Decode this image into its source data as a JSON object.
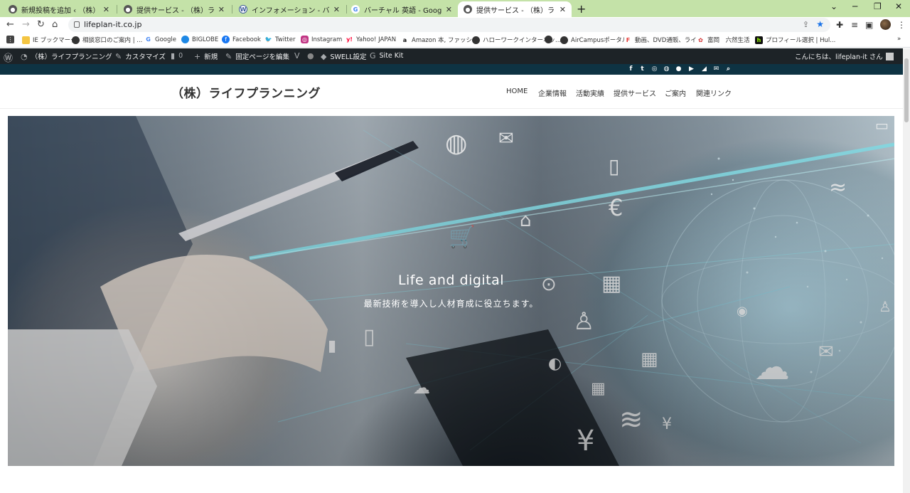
{
  "browser": {
    "tabs": [
      {
        "title": "新規投稿を追加 ‹ （株）ライフプラ",
        "icon": "wp-globe-icon",
        "active": false
      },
      {
        "title": "提供サービス - （株）ライフプランニン",
        "icon": "wp-globe-icon",
        "active": false
      },
      {
        "title": "インフォメーション - バーチャル富岡ス",
        "icon": "wordpress-icon",
        "active": false
      },
      {
        "title": "バーチャル 英語 - Google 検索",
        "icon": "google-icon",
        "active": false
      },
      {
        "title": "提供サービス - （株）ライフプランニン",
        "icon": "wp-globe-icon",
        "active": true
      }
    ],
    "new_tab": "+",
    "url": "lifeplan-it.co.jp",
    "bookmarks": [
      {
        "label": "IE ブックマーク",
        "icon": "folder-icon",
        "color": "#f4c542"
      },
      {
        "label": "相談窓口のご案内 | ...",
        "icon": "globe-icon",
        "color": "#333333"
      },
      {
        "label": "Google",
        "icon": "google-icon",
        "color": "#4285f4"
      },
      {
        "label": "BIGLOBE",
        "icon": "biglobe-icon",
        "color": "#1e88e5"
      },
      {
        "label": "Facebook",
        "icon": "facebook-icon",
        "color": "#1877f2"
      },
      {
        "label": "Twitter",
        "icon": "twitter-icon",
        "color": "#1da1f2"
      },
      {
        "label": "Instagram",
        "icon": "instagram-icon",
        "color": "#c13584"
      },
      {
        "label": "Yahoo! JAPAN",
        "icon": "yahoo-icon",
        "color": "#ff0033"
      },
      {
        "label": "Amazon 本, ファッシ...",
        "icon": "amazon-icon",
        "color": "#111111"
      },
      {
        "label": "ハローワークインターネッ...",
        "icon": "globe-icon",
        "color": "#333333"
      },
      {
        "label": "",
        "icon": "globe-icon",
        "color": "#333333"
      },
      {
        "label": "AirCampusポータル",
        "icon": "globe-icon",
        "color": "#333333"
      },
      {
        "label": "動画、DVD通販、ライ...",
        "icon": "fanza-icon",
        "color": "#e53935"
      },
      {
        "label": "富岡　六然生活",
        "icon": "tomioka-icon",
        "color": "#d32f2f"
      },
      {
        "label": "プロフィール選択 | Hul...",
        "icon": "hulu-icon",
        "color": "#111111"
      }
    ]
  },
  "adminbar": {
    "site_name": "（株）ライフプランニング",
    "customize": "カスタマイズ",
    "comments": "0",
    "new": "新規",
    "edit_page": "固定ページを編集",
    "swell": "SWELL設定",
    "sitekit": "Site Kit",
    "greeting": "こんにちは、lifeplan-it さん"
  },
  "site": {
    "logo": "（株）ライフプランニング",
    "nav": [
      "HOME",
      "企業情報",
      "活動実績",
      "提供サービス",
      "ご案内",
      "関連リンク"
    ],
    "sns_icons": [
      "facebook-icon",
      "twitter-icon",
      "instagram-icon",
      "line-icon",
      "github-icon",
      "youtube-icon",
      "rss-icon",
      "mail-icon",
      "search-icon"
    ]
  },
  "hero": {
    "title": "Life and digital",
    "subtitle": "最新技術を導入し人材育成に役立ちます。"
  }
}
